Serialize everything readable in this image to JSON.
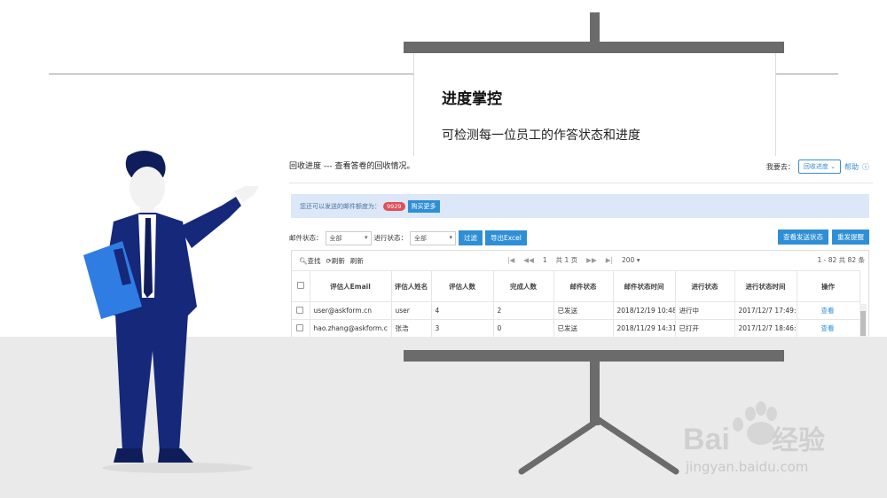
{
  "slide": {
    "heading": "进度掌控",
    "subtext": "可检测每一位员工的作答状态和进度"
  },
  "app": {
    "title": "回收进度 --- 查看答卷的回收情况。",
    "goto_label": "我要去：",
    "goto_select": "回收进度 ⌄",
    "help": "帮助",
    "notice_text": "您还可以发送的邮件额度为：",
    "quota": "9929",
    "buy_button": "购买更多",
    "filter": {
      "mail_status_label": "邮件状态：",
      "mail_status_value": "全部",
      "progress_status_label": "进行状态：",
      "progress_status_value": "全部",
      "filter_button": "过滤",
      "export_button": "导出Excel",
      "view_send_status_button": "查看发送状态",
      "resend_button": "重发提醒"
    },
    "toolbar": {
      "search": "查找",
      "refresh": "刷新",
      "refresh2": "刷新",
      "page": "1",
      "total_pages": "共 1 页",
      "page_size": "200",
      "range": "1 - 82  共 82 条"
    },
    "columns": [
      "评估人Email",
      "评估人姓名",
      "评估人数",
      "完成人数",
      "邮件状态",
      "邮件状态时间",
      "进行状态",
      "进行状态时间",
      "操作"
    ],
    "rows": [
      {
        "email": "user@askform.cn",
        "name": "user",
        "evaluators": "4",
        "done": "2",
        "mail_status": "已发送",
        "mail_time": "2018/12/19 10:48",
        "status": "进行中",
        "status_time": "2017/12/7 17:49:",
        "action": "查看"
      },
      {
        "email": "hao.zhang@askform.c",
        "name": "张浩",
        "evaluators": "3",
        "done": "0",
        "mail_status": "已发送",
        "mail_time": "2018/11/29 14:31",
        "status": "已打开",
        "status_time": "2017/12/7 18:46:",
        "action": "查看"
      }
    ]
  },
  "watermark": {
    "url": "jingyan.baidu.com"
  }
}
